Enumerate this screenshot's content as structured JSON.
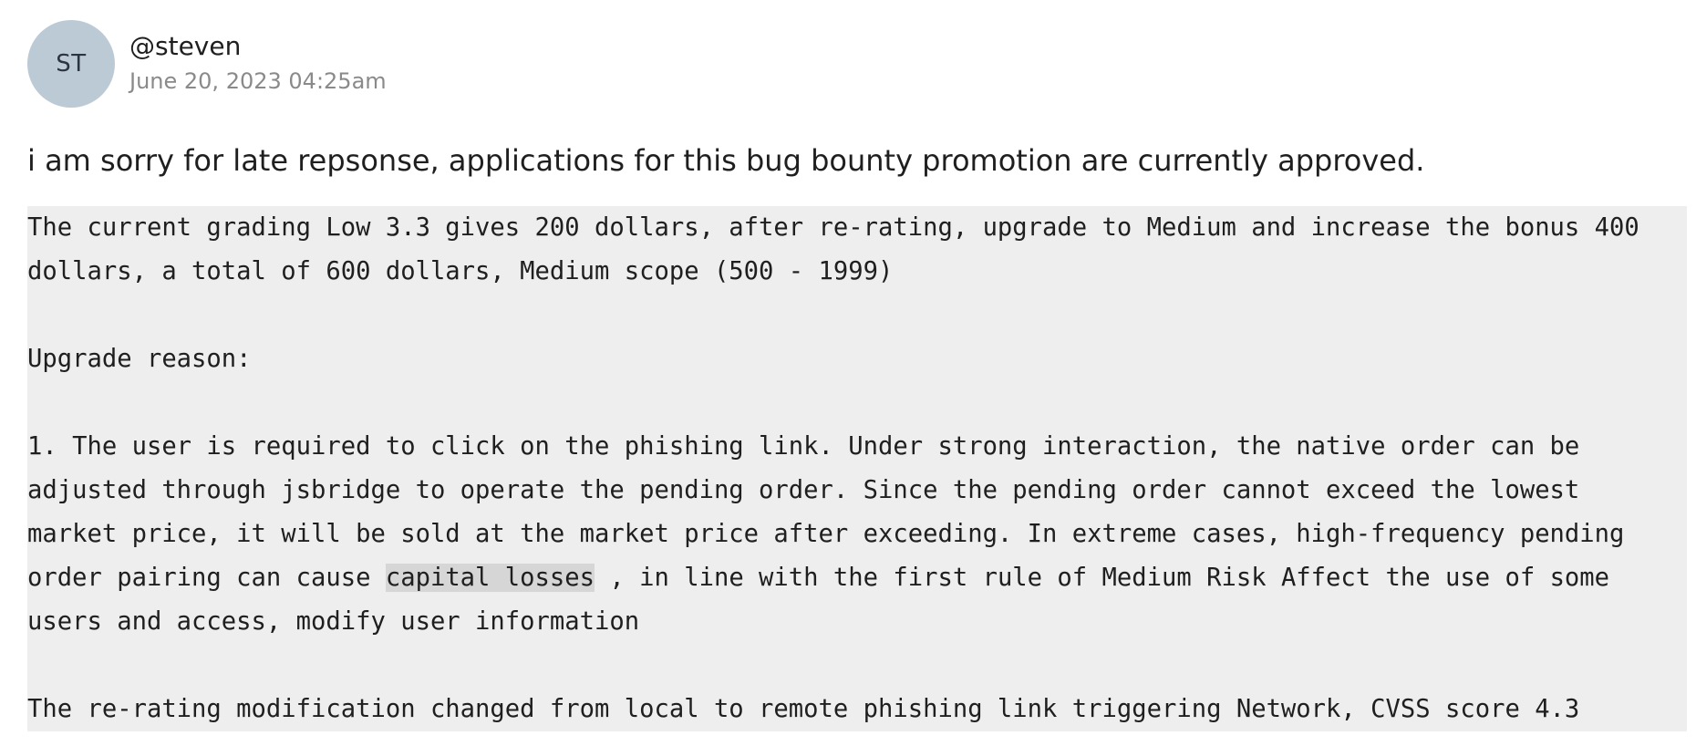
{
  "post": {
    "avatar_initials": "ST",
    "avatar_color": "#bccad6",
    "username": "@steven",
    "timestamp": "June 20, 2023 04:25am",
    "message": "i am sorry for late repsonse, applications for this bug bounty promotion are currently approved."
  },
  "code_block": {
    "background": "#eeeeee",
    "lines": [
      "The current grading Low 3.3 gives 200 dollars, after re-rating, upgrade to Medium and increase the bonus 400",
      "dollars, a total of 600 dollars, Medium scope (500 - 1999)",
      "",
      "Upgrade reason:",
      "",
      "1. The user is required to click on the phishing link. Under strong interaction, the native order can be",
      "adjusted through jsbridge to operate the pending order. Since the pending order cannot exceed the lowest",
      "market price, it will be sold at the market price after exceeding. In extreme cases, high-frequency pending",
      "order pairing can cause ",
      "capital losses",
      " , in line with the first rule of Medium Risk Affect the use of some",
      "users and access, modify user information",
      "",
      "The re-rating modification changed from local to remote phishing link triggering Network, CVSS score 4.3"
    ]
  }
}
